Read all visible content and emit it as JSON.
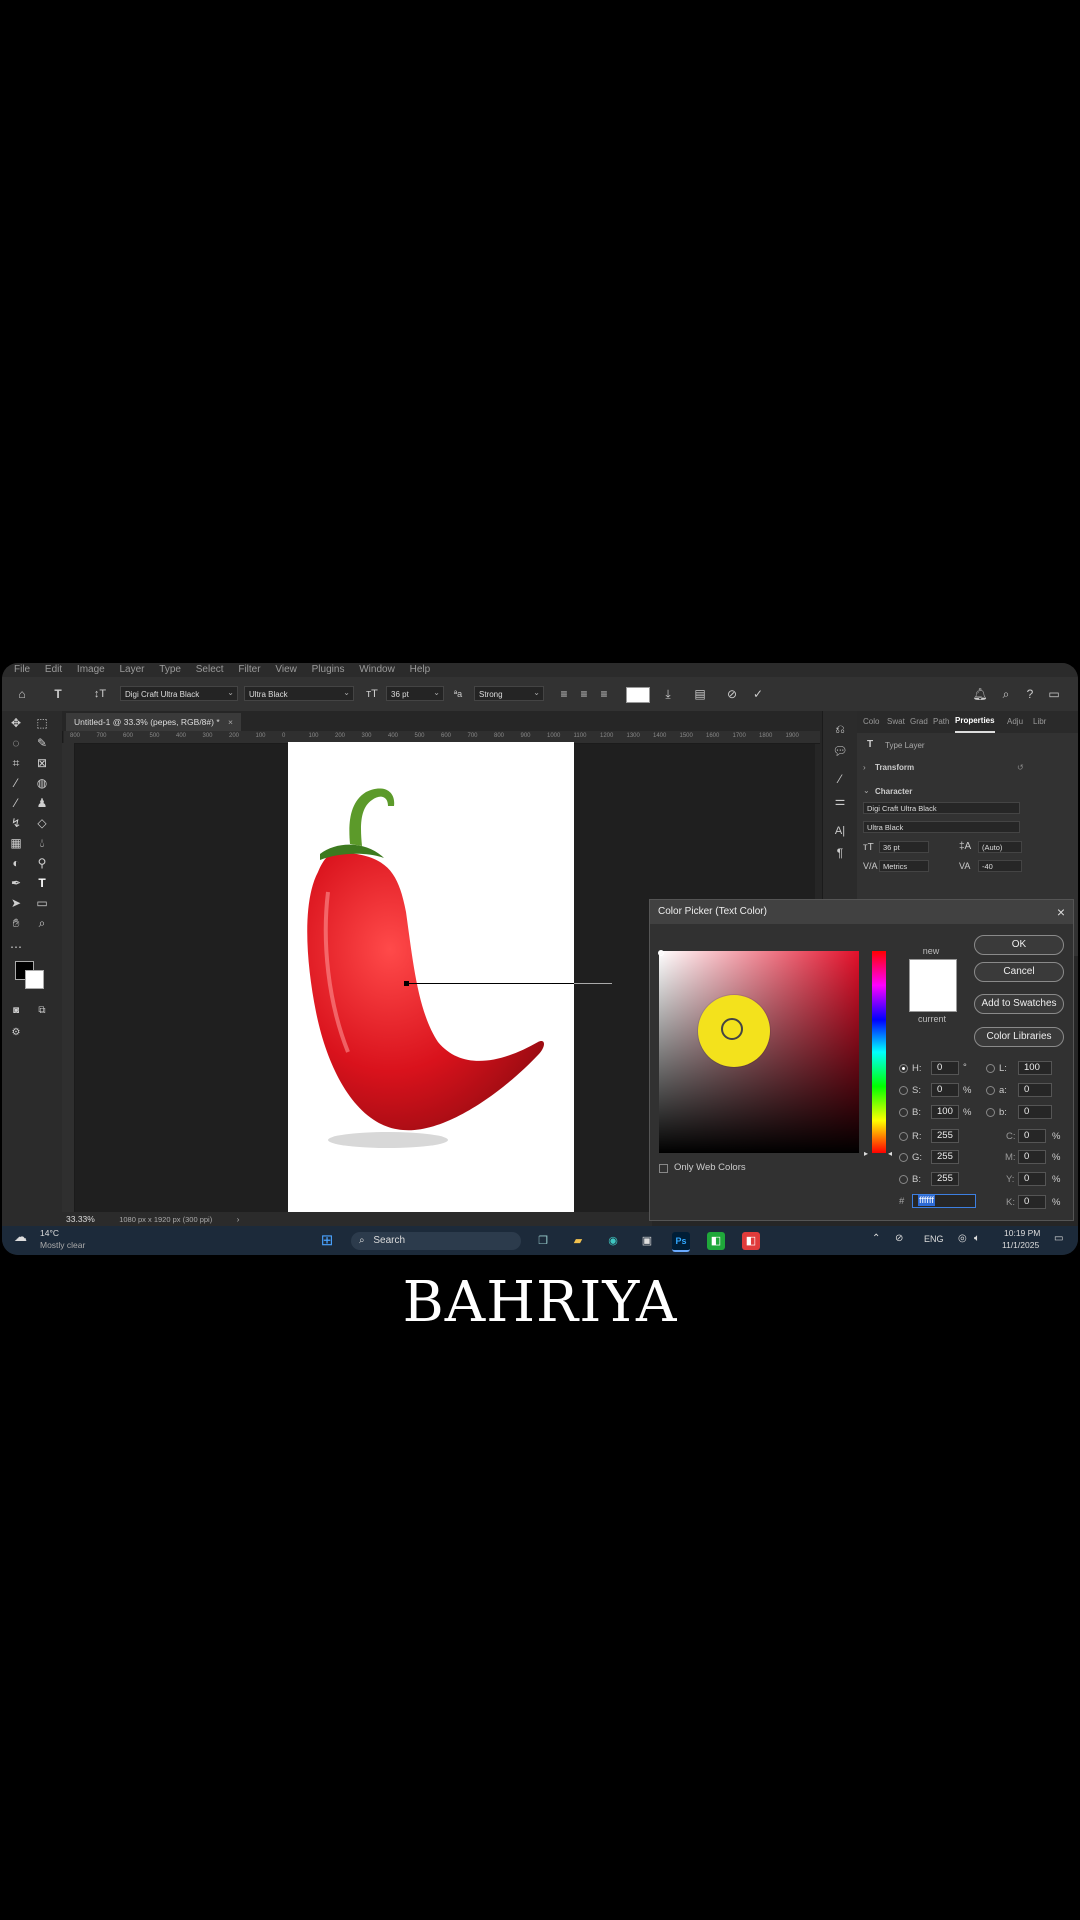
{
  "menu": [
    "File",
    "Edit",
    "Image",
    "Layer",
    "Type",
    "Select",
    "Filter",
    "View",
    "Plugins",
    "Window",
    "Help"
  ],
  "options": {
    "font_family": "Digi Craft Ultra Black",
    "font_style": "Ultra Black",
    "font_size": "36 pt",
    "antialias": "Strong"
  },
  "document": {
    "tab_title": "Untitled-1 @ 33.3% (pepes, RGB/8#) *"
  },
  "ruler_ticks": [
    "800",
    "700",
    "600",
    "500",
    "400",
    "300",
    "200",
    "100",
    "0",
    "100",
    "200",
    "300",
    "400",
    "500",
    "600",
    "700",
    "800",
    "900",
    "1000",
    "1100",
    "1200",
    "1300",
    "1400",
    "1500",
    "1600",
    "1700",
    "1800",
    "1900"
  ],
  "status": {
    "zoom": "33.33%",
    "info": "1080 px x 1920 px (300 ppi)"
  },
  "panel": {
    "tabs": [
      "Colo",
      "Swat",
      "Grad",
      "Path",
      "Properties",
      "Adju",
      "Libr"
    ],
    "active_tab": "Properties",
    "type_layer": "Type Layer",
    "transform": "Transform",
    "character": "Character",
    "font_family": "Digi Craft Ultra Black",
    "font_style": "Ultra Black",
    "size": "36 pt",
    "leading": "(Auto)",
    "kerning": "Metrics",
    "tracking": "-40"
  },
  "color_picker": {
    "title": "Color Picker (Text Color)",
    "new_label": "new",
    "current_label": "current",
    "buttons": {
      "ok": "OK",
      "cancel": "Cancel",
      "add_swatches": "Add to Swatches",
      "libraries": "Color Libraries"
    },
    "only_web_colors": "Only Web Colors",
    "hsb": {
      "H": "0",
      "S": "0",
      "B": "100"
    },
    "rgb": {
      "R": "255",
      "G": "255",
      "B": "255"
    },
    "lab": {
      "L": "100",
      "a": "0",
      "b": "0"
    },
    "cmyk": {
      "C": "0",
      "M": "0",
      "Y": "0",
      "K": "0"
    },
    "hex": "ffffff",
    "units": {
      "deg": "°",
      "pct": "%"
    },
    "new_color": "#ffffff",
    "current_color": "#ffffff"
  },
  "taskbar": {
    "weather_temp": "14°C",
    "weather_text": "Mostly clear",
    "search_label": "Search",
    "lang": "ENG",
    "time": "10:19 PM",
    "date": "11/1/2025"
  },
  "brand_text": "BAHRIYA"
}
